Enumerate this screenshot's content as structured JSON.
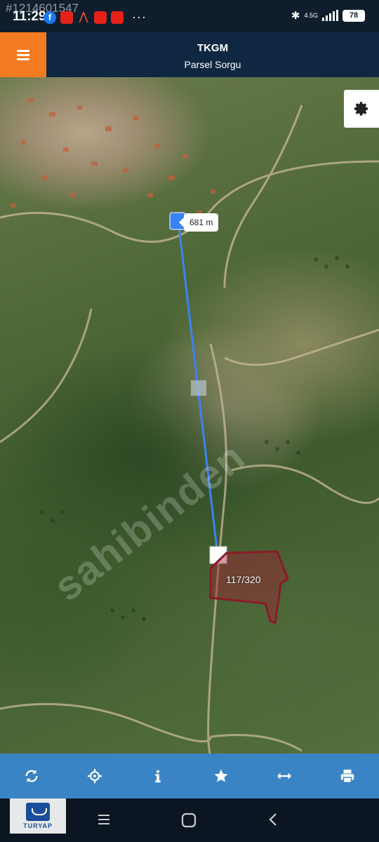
{
  "status_bar": {
    "overlay_id": "#1214601547",
    "time": "11:29",
    "more_indicator": "···",
    "network": "4.5G",
    "battery": "78"
  },
  "header": {
    "menu_icon": "hamburger-icon",
    "title": "TKGM",
    "subtitle": "Parsel Sorgu"
  },
  "map": {
    "distance": "681 m",
    "parcel_label": "117/320",
    "watermark": "sahibinden",
    "settings_icon": "gear-icon",
    "route_color": "#3b82f6",
    "parcel_color": "#8b1a2b"
  },
  "toolbar": {
    "items": [
      {
        "name": "refresh",
        "icon": "refresh-icon"
      },
      {
        "name": "locate",
        "icon": "crosshair-icon"
      },
      {
        "name": "info",
        "icon": "info-icon"
      },
      {
        "name": "favorite",
        "icon": "star-icon"
      },
      {
        "name": "measure",
        "icon": "arrows-horizontal-icon"
      },
      {
        "name": "print",
        "icon": "print-icon"
      }
    ],
    "background": "#3a84c6"
  },
  "logo": {
    "text": "TURYAP"
  },
  "navbar": {
    "icons": [
      "recent-apps-icon",
      "home-icon",
      "back-icon"
    ]
  }
}
